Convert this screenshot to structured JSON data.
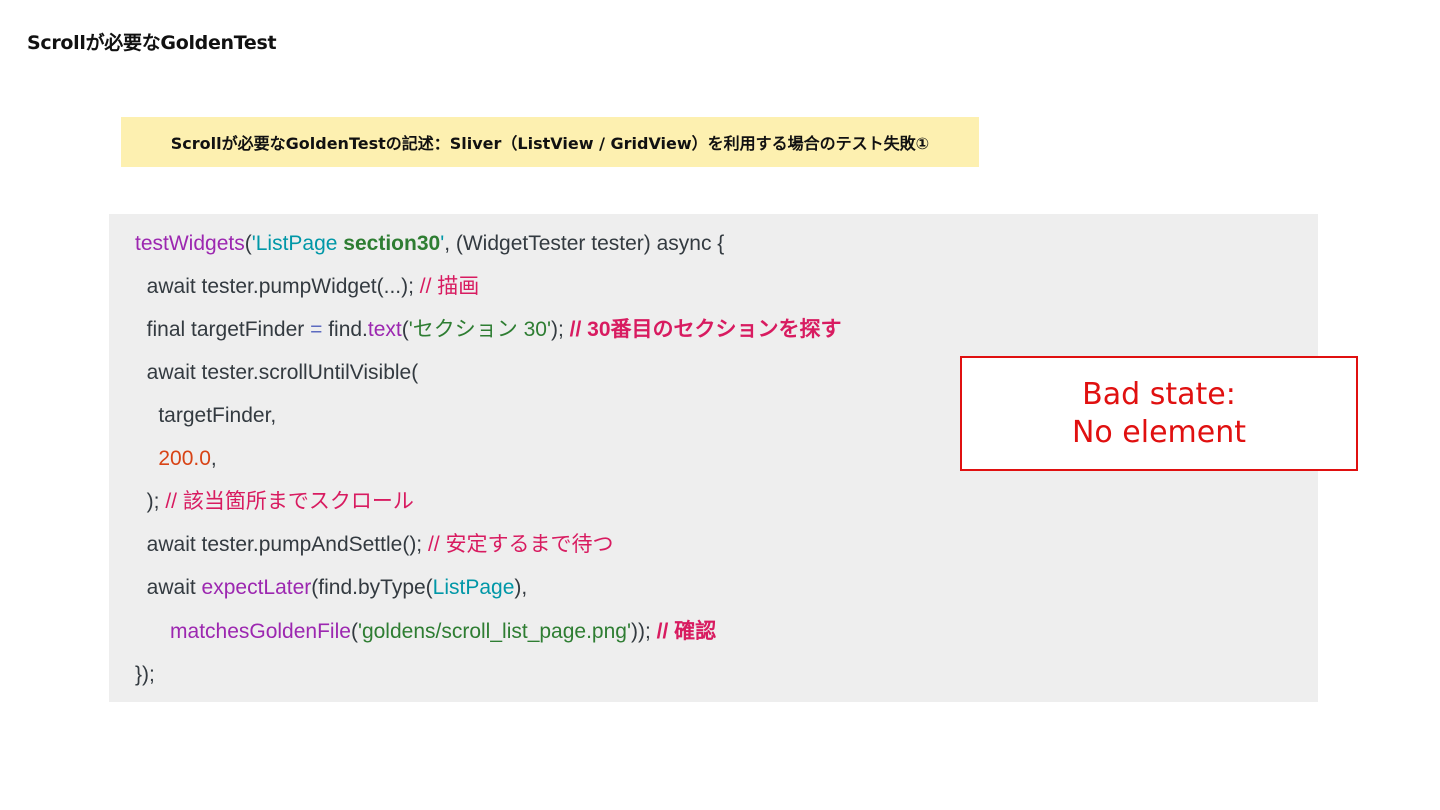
{
  "page": {
    "title": "Scrollが必要なGoldenTest",
    "subtitle": "Scrollが必要なGoldenTestの記述：Sliver（ListView / GridView）を利用する場合のテスト失敗①"
  },
  "code": {
    "l1": {
      "fn": "testWidgets",
      "p1": "(",
      "s1": "'ListPage ",
      "s2": "section30",
      "s3": "'",
      "rest": ", (WidgetTester tester) async {"
    },
    "l2": {
      "code": "  await tester.pumpWidget(...); ",
      "comment": "// 描画"
    },
    "l3": {
      "a": "  final targetFinder ",
      "op": "=",
      "b": " find.",
      "fn": "text",
      "p": "(",
      "str": "'セクション 30'",
      "c": "); ",
      "comment": "// 30番目のセクションを探す"
    },
    "l4": {
      "code": "  await tester.scrollUntilVisible("
    },
    "l5": {
      "code": "    targetFinder,"
    },
    "l6": {
      "indent": "    ",
      "num": "200.0",
      "rest": ","
    },
    "l7": {
      "code": "  ); ",
      "comment": "// 該当箇所までスクロール"
    },
    "l8": {
      "code": "  await tester.pumpAndSettle(); ",
      "comment": "// 安定するまで待つ"
    },
    "l9": {
      "a": "  await ",
      "fn": "expectLater",
      "b": "(find.byType(",
      "cls": "ListPage",
      "c": "),"
    },
    "l10": {
      "indent": "      ",
      "fn": "matchesGoldenFile",
      "p": "(",
      "str": "'goldens/scroll_list_page.png'",
      "c": ")); ",
      "comment": "// 確認"
    },
    "l11": {
      "code": "});"
    }
  },
  "error": {
    "line1": "Bad state:",
    "line2": "No element"
  },
  "colors": {
    "banner_bg": "#fdf0b0",
    "code_bg": "#eeeeee",
    "error_red": "#e01010",
    "fn_purple": "#9c27b0",
    "cls_teal": "#0097a7",
    "string_green": "#2e7d32",
    "number_orange": "#d84315",
    "comment_pink": "#d81b60"
  }
}
